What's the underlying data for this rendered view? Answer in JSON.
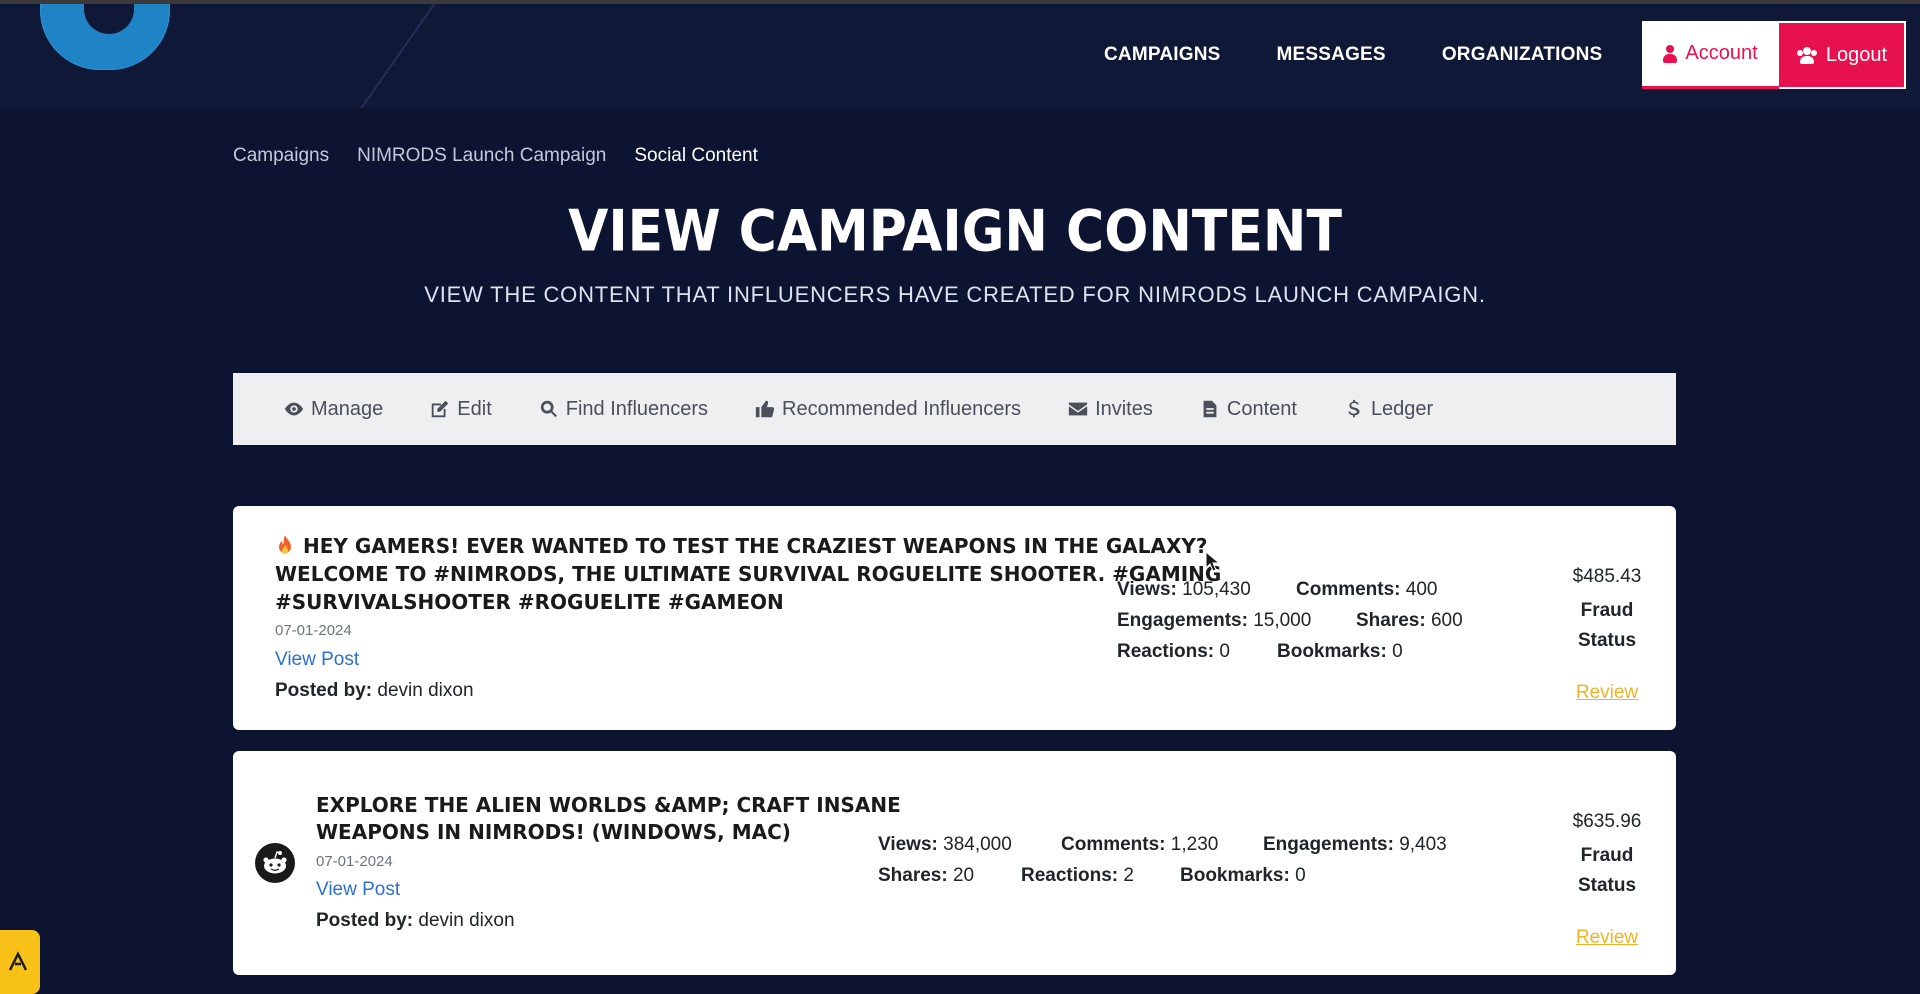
{
  "nav": {
    "links": [
      "CAMPAIGNS",
      "MESSAGES",
      "ORGANIZATIONS"
    ],
    "account_label": "Account",
    "logout_label": "Logout"
  },
  "breadcrumb": [
    "Campaigns",
    "NIMRODS Launch Campaign",
    "Social Content"
  ],
  "page": {
    "title": "VIEW CAMPAIGN CONTENT",
    "subtitle": "VIEW THE CONTENT THAT INFLUENCERS HAVE CREATED FOR NIMRODS LAUNCH CAMPAIGN."
  },
  "tabs": [
    {
      "label": "Manage",
      "icon": "eye-icon"
    },
    {
      "label": "Edit",
      "icon": "edit-icon"
    },
    {
      "label": "Find Influencers",
      "icon": "search-icon"
    },
    {
      "label": "Recommended Influencers",
      "icon": "thumbs-up-icon"
    },
    {
      "label": "Invites",
      "icon": "envelope-icon"
    },
    {
      "label": "Content",
      "icon": "file-icon"
    },
    {
      "label": "Ledger",
      "icon": "dollar-icon"
    }
  ],
  "posts": [
    {
      "title_line1": "HEY GAMERS! EVER WANTED TO TEST THE CRAZIEST WEAPONS IN THE GALAXY?",
      "title_line2": "WELCOME TO #NIMRODS, THE ULTIMATE SURVIVAL ROGUELITE SHOOTER. #GAMING",
      "title_line3": "#SURVIVALSHOOTER #ROGUELITE #GAMEON",
      "date": "07-01-2024",
      "view_post": "View Post",
      "posted_by_label": "Posted by:",
      "posted_by": "devin dixon",
      "views_label": "Views:",
      "views": "105,430",
      "comments_label": "Comments:",
      "comments": "400",
      "engagements_label": "Engagements:",
      "engagements": "15,000",
      "shares_label": "Shares:",
      "shares": "600",
      "reactions_label": "Reactions:",
      "reactions": "0",
      "bookmarks_label": "Bookmarks:",
      "bookmarks": "0",
      "price": "$485.43",
      "fraud_line1": "Fraud",
      "fraud_line2": "Status",
      "review": "Review",
      "icon": "fire-icon"
    },
    {
      "title_line1": "EXPLORE THE ALIEN WORLDS &AMP; CRAFT INSANE",
      "title_line2": "WEAPONS IN NIMRODS! (WINDOWS, MAC)",
      "date": "07-01-2024",
      "view_post": "View Post",
      "posted_by_label": "Posted by:",
      "posted_by": "devin dixon",
      "views_label": "Views:",
      "views": "384,000",
      "comments_label": "Comments:",
      "comments": "1,230",
      "engagements_label": "Engagements:",
      "engagements": "9,403",
      "shares_label": "Shares:",
      "shares": "20",
      "reactions_label": "Reactions:",
      "reactions": "2",
      "bookmarks_label": "Bookmarks:",
      "bookmarks": "0",
      "price": "$635.96",
      "fraud_line1": "Fraud",
      "fraud_line2": "Status",
      "review": "Review",
      "icon": "reddit-icon"
    }
  ],
  "colors": {
    "background": "#0c1431",
    "accent": "#e8114f",
    "link": "#2c6fd1",
    "review": "#f0b323"
  }
}
